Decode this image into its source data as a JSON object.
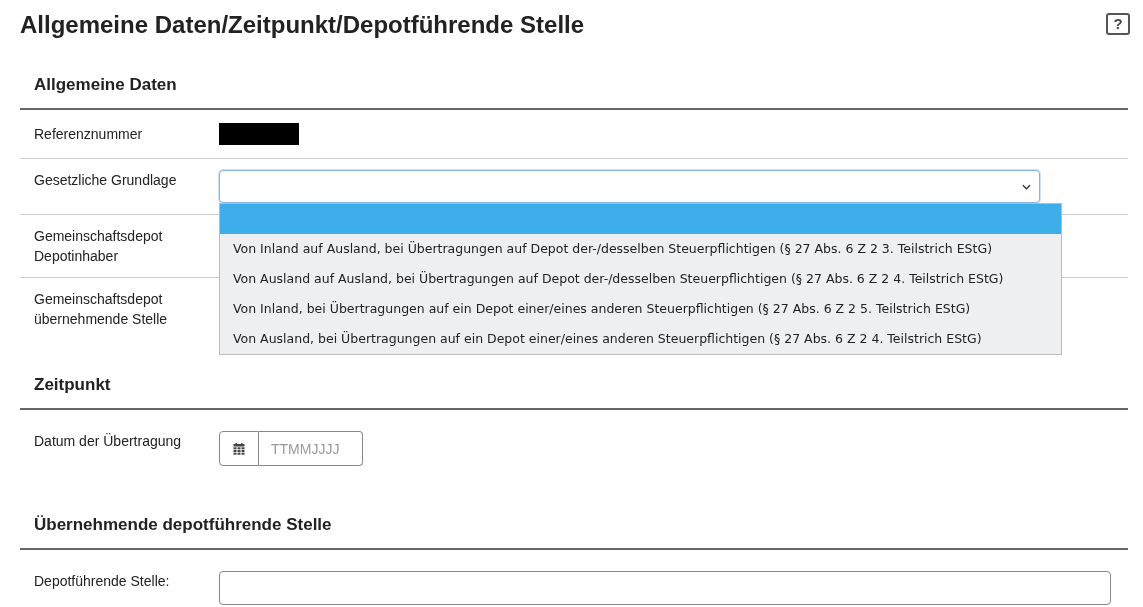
{
  "page": {
    "title": "Allgemeine Daten/Zeitpunkt/Depotführende Stelle",
    "help_button": "?"
  },
  "sections": [
    {
      "title": "Allgemeine Daten",
      "rows": [
        {
          "kind": "redacted",
          "label": "Referenznummer"
        },
        {
          "kind": "select",
          "label": "Gesetzliche Grundlage",
          "expanded": true,
          "options": [
            {
              "selected": true
            },
            {
              "label": "Von Inland auf Ausland, bei Übertragungen auf Depot der-/desselben Steuerpflichtigen (§ 27 Abs. 6 Z 2 3. Teilstrich EStG)",
              "selected": false
            },
            {
              "label": "Von Ausland auf Ausland, bei Übertragungen auf Depot der-/desselben Steuerpflichtigen (§ 27 Abs. 6 Z 2 4. Teilstrich EStG)",
              "selected": false
            },
            {
              "label": "Von Inland, bei Übertragungen auf ein Depot einer/eines anderen Steuerpflichtigen (§ 27 Abs. 6 Z 2 5. Teilstrich EStG)",
              "selected": false
            },
            {
              "label": "Von Ausland, bei Übertragungen auf ein Depot einer/eines anderen Steuerpflichtigen (§ 27 Abs. 6 Z 2 4. Teilstrich EStG)",
              "selected": false
            }
          ]
        },
        {
          "kind": "covered",
          "label": "Gemeinschaftsdepot Depotinhaber"
        },
        {
          "kind": "covered",
          "label": "Gemeinschaftsdepot übernehmende Stelle"
        }
      ]
    },
    {
      "title": "Zeitpunkt",
      "rows": [
        {
          "kind": "date",
          "label": "Datum der Übertragung",
          "placeholder": "TTMMJJJJ"
        }
      ]
    },
    {
      "title": "Übernehmende depotführende Stelle",
      "rows": [
        {
          "kind": "text",
          "label": "Depotführende Stelle:"
        }
      ]
    }
  ]
}
